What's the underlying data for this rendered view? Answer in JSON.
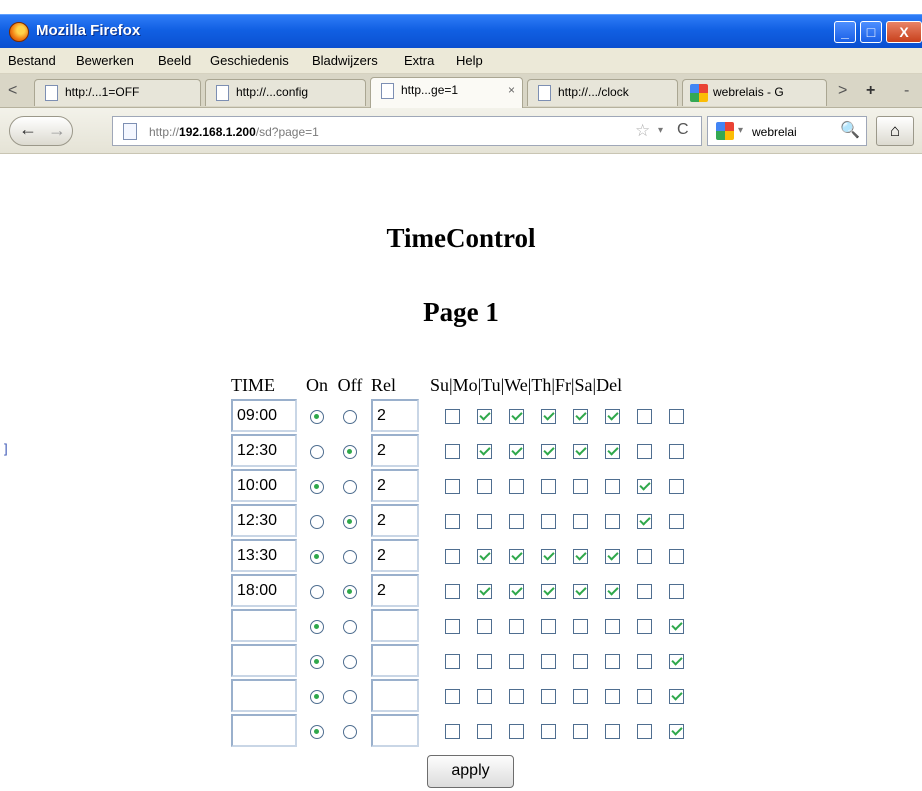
{
  "window": {
    "title": "Mozilla Firefox",
    "min": "_",
    "max": "□",
    "close": "X"
  },
  "menu": [
    "Bestand",
    "Bewerken",
    "Beeld",
    "Geschiedenis",
    "Bladwijzers",
    "Extra",
    "Help"
  ],
  "tabs": [
    {
      "label": "http:/...1=OFF",
      "icon": "page-icon",
      "active": false
    },
    {
      "label": "http://...config",
      "icon": "page-icon",
      "active": false
    },
    {
      "label": "http...ge=1",
      "icon": "page-icon",
      "active": true
    },
    {
      "label": "http://.../clock",
      "icon": "page-icon",
      "active": false
    },
    {
      "label": "webrelais - G",
      "icon": "google-icon",
      "active": false
    }
  ],
  "tab_controls": {
    "prev": "<",
    "next": ">",
    "new": "+",
    "list": "-",
    "close": "×"
  },
  "navbar": {
    "back": "←",
    "forward": "→",
    "url_prefix": "http://",
    "url_host": "192.168.1.200",
    "url_path": "/sd?page=1",
    "star": "☆",
    "dropdown": "▾",
    "reload": "C",
    "search_text": "webrelai",
    "search_icon": "🔍",
    "home": "⌂"
  },
  "page": {
    "title": "TimeControl",
    "subtitle": "Page 1",
    "side_char": "]",
    "headers": {
      "time": "TIME",
      "on": "On",
      "off": "Off",
      "rel": "Rel",
      "days": "Su|Mo|Tu|We|Th|Fr|Sa|Del"
    },
    "rows": [
      {
        "time": "09:00",
        "on": true,
        "rel": "2",
        "days": [
          false,
          true,
          true,
          true,
          true,
          true,
          false,
          false
        ]
      },
      {
        "time": "12:30",
        "on": false,
        "rel": "2",
        "days": [
          false,
          true,
          true,
          true,
          true,
          true,
          false,
          false
        ]
      },
      {
        "time": "10:00",
        "on": true,
        "rel": "2",
        "days": [
          false,
          false,
          false,
          false,
          false,
          false,
          true,
          false
        ]
      },
      {
        "time": "12:30",
        "on": false,
        "rel": "2",
        "days": [
          false,
          false,
          false,
          false,
          false,
          false,
          true,
          false
        ]
      },
      {
        "time": "13:30",
        "on": true,
        "rel": "2",
        "days": [
          false,
          true,
          true,
          true,
          true,
          true,
          false,
          false
        ]
      },
      {
        "time": "18:00",
        "on": false,
        "rel": "2",
        "days": [
          false,
          true,
          true,
          true,
          true,
          true,
          false,
          false
        ]
      },
      {
        "time": "",
        "on": true,
        "rel": "",
        "days": [
          false,
          false,
          false,
          false,
          false,
          false,
          false,
          true
        ]
      },
      {
        "time": "",
        "on": true,
        "rel": "",
        "days": [
          false,
          false,
          false,
          false,
          false,
          false,
          false,
          true
        ]
      },
      {
        "time": "",
        "on": true,
        "rel": "",
        "days": [
          false,
          false,
          false,
          false,
          false,
          false,
          false,
          true
        ]
      },
      {
        "time": "",
        "on": true,
        "rel": "",
        "days": [
          false,
          false,
          false,
          false,
          false,
          false,
          false,
          true
        ]
      }
    ],
    "apply_label": "apply"
  }
}
